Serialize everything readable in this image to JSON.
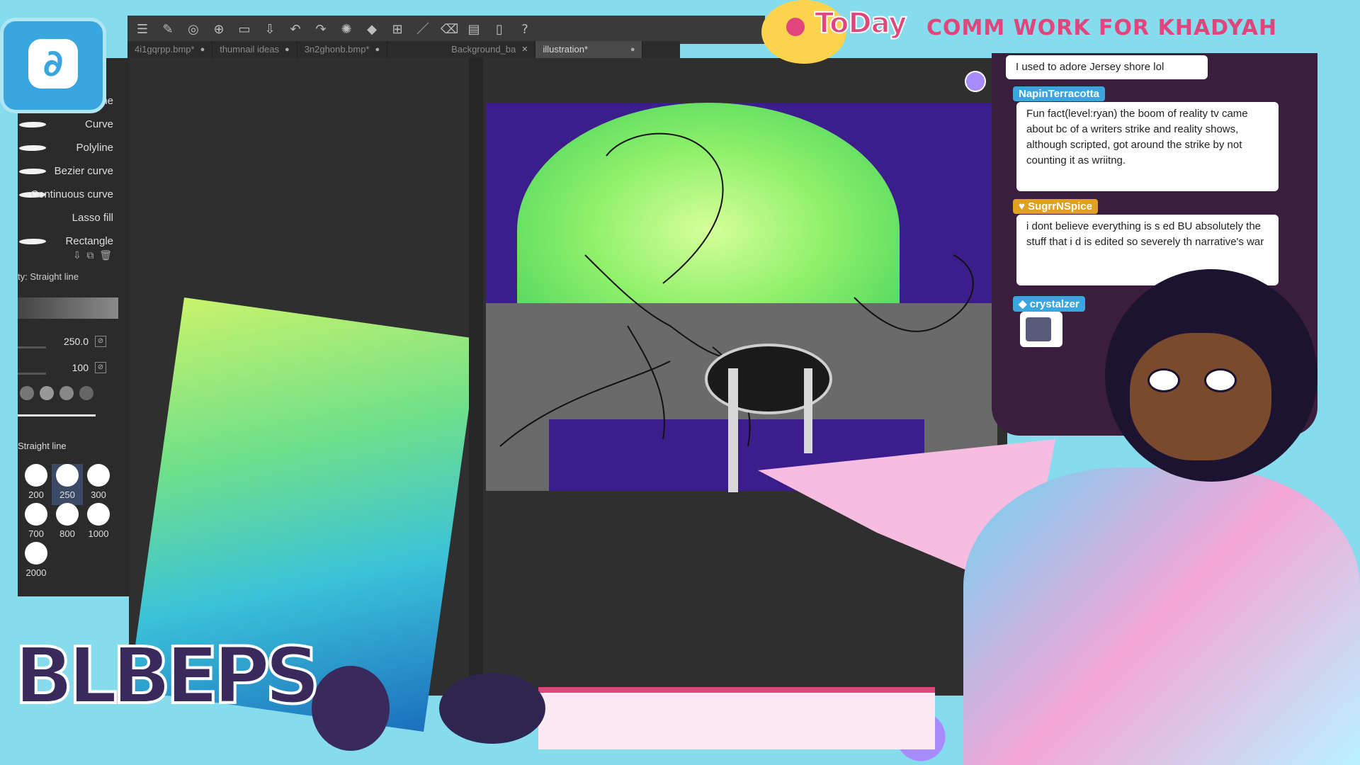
{
  "banner": {
    "today": "ToDay",
    "title": "COMM WORK FOR KHADYAH"
  },
  "tabs": [
    {
      "label": "4i1gqrpp.bmp*",
      "active": false,
      "closable": false
    },
    {
      "label": "thumnail ideas",
      "active": false,
      "closable": false
    },
    {
      "label": "3n2ghonb.bmp*",
      "active": false,
      "closable": false
    },
    {
      "label": "Background_ba",
      "active": false,
      "closable": true
    },
    {
      "label": "illustration*",
      "active": true,
      "closable": false
    }
  ],
  "toolbar": {
    "icons": [
      "menu-icon",
      "edit-icon",
      "brush-icon",
      "new-file-icon",
      "open-folder-icon",
      "save-icon",
      "undo-icon",
      "redo-icon",
      "loading-icon",
      "fill-icon",
      "transform-icon",
      "pen-icon",
      "eraser-icon",
      "ruler-icon",
      "phone-icon",
      "help-icon"
    ]
  },
  "tools": {
    "partial_label": "ne",
    "items": [
      "Curve",
      "Polyline",
      "Bezier curve",
      "Continuous curve",
      "Lasso fill",
      "Rectangle"
    ]
  },
  "tool_property": {
    "title": "ty: Straight line",
    "size_value": "250.0",
    "opacity_value": "100"
  },
  "brush_size": {
    "title": "Straight line",
    "sizes": [
      "200",
      "250",
      "300",
      "700",
      "800",
      "1000",
      "2000"
    ],
    "selected": "250"
  },
  "chat": {
    "messages": [
      {
        "user": "",
        "text": "I used to adore Jersey shore lol",
        "color": ""
      },
      {
        "user": "NapinTerracotta",
        "text": "Fun fact(level:ryan) the boom of reality tv came about bc of a writers strike and reality shows, although scripted, got around the strike by not counting it as wriitng.",
        "color": "#3aa6df"
      },
      {
        "user": "SugrrNSpice",
        "text": "i dont believe everything is s ed BU absolutely the stuff that i d is edited so severely th narrative's war",
        "color": "#e0a020"
      },
      {
        "user": "crystalzer",
        "text": "",
        "color": "#3aa6df"
      }
    ]
  },
  "logo": {
    "text": "BLBEPS"
  },
  "colors": {
    "accent_pink": "#e0457b",
    "panel_dark": "#2b2b2b",
    "chat_bg": "#3a1e3e"
  }
}
